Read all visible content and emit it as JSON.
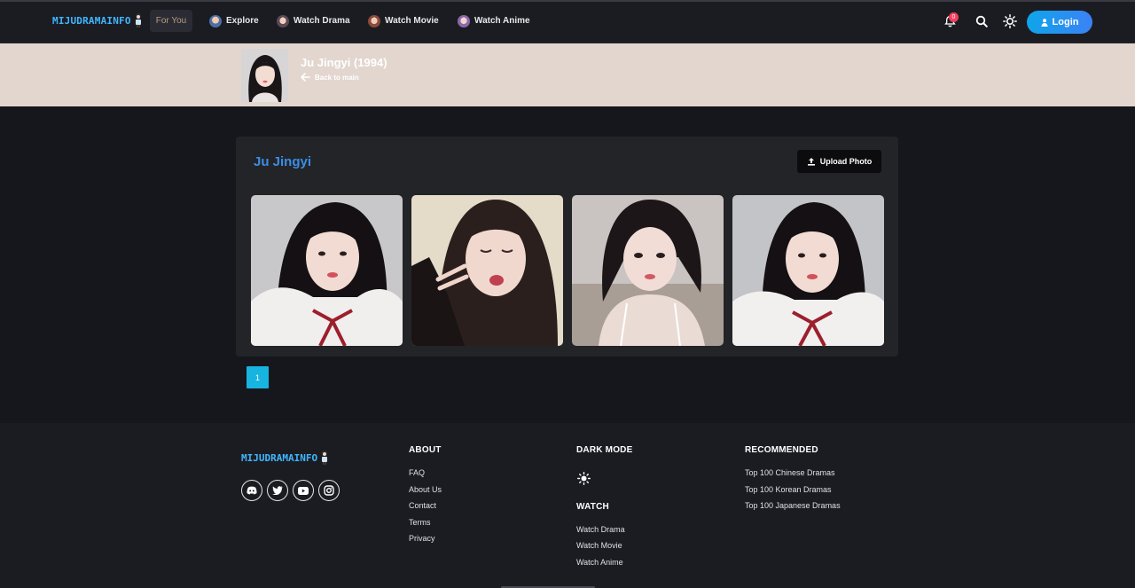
{
  "nav": {
    "logo": "MIJUDRAMAINFO",
    "items": [
      {
        "label": "For You"
      },
      {
        "label": "Explore"
      },
      {
        "label": "Watch Drama"
      },
      {
        "label": "Watch Movie"
      },
      {
        "label": "Watch Anime"
      }
    ],
    "notification_count": "0",
    "login_label": "Login"
  },
  "profile": {
    "name": "Ju Jingyi (1994)",
    "back_label": "Back to main"
  },
  "gallery": {
    "title": "Ju Jingyi",
    "upload_label": "Upload Photo",
    "photo_count": 4
  },
  "pagination": {
    "current_page": "1"
  },
  "footer": {
    "logo": "MIJUDRAMAINFO",
    "social": [
      "discord-icon",
      "twitter-icon",
      "youtube-icon",
      "instagram-icon"
    ],
    "about": {
      "heading": "ABOUT",
      "links": [
        "FAQ",
        "About Us",
        "Contact",
        "Terms",
        "Privacy"
      ]
    },
    "dark_mode": {
      "heading": "DARK MODE"
    },
    "watch": {
      "heading": "WATCH",
      "links": [
        "Watch Drama",
        "Watch Movie",
        "Watch Anime"
      ]
    },
    "recommended": {
      "heading": "RECOMMENDED",
      "links": [
        "Top 100 Chinese Dramas",
        "Top 100 Korean Dramas",
        "Top 100 Japanese Dramas"
      ]
    }
  },
  "colors": {
    "accent": "#17b4e0",
    "logo": "#3fb6ff",
    "title_blue": "#3a8ee6",
    "band": "#e2d6cf",
    "background": "#16171d"
  }
}
